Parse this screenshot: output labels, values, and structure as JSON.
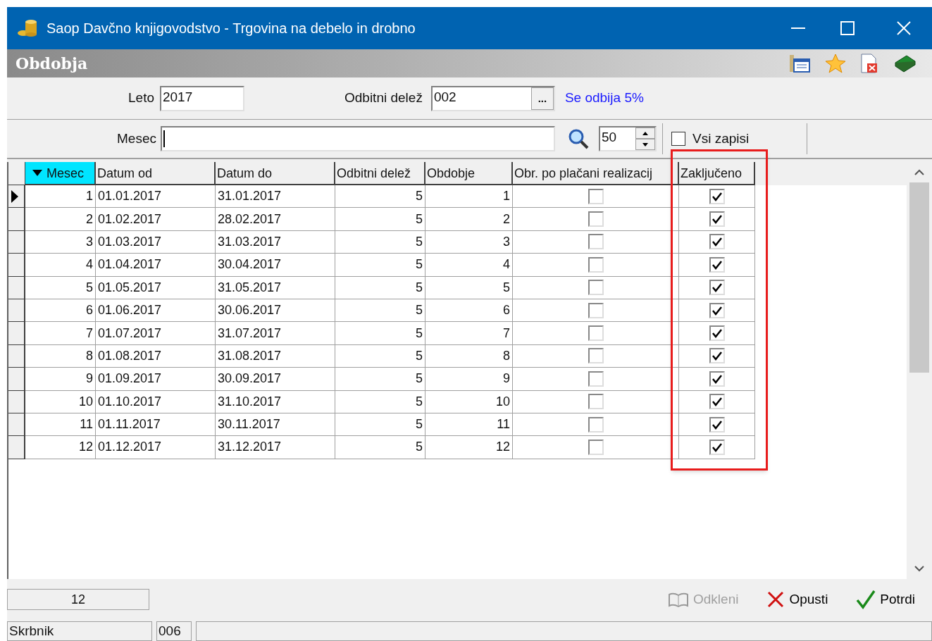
{
  "window": {
    "title": "Saop Davčno knjigovodstvo - Trgovina na debelo in drobno"
  },
  "panel_title": "Obdobja",
  "form": {
    "leto_label": "Leto",
    "leto_value": "2017",
    "delez_label": "Odbitni delež",
    "delez_value": "002",
    "delez_button": "...",
    "delez_note": "Se odbija 5%",
    "mesec_label": "Mesec",
    "page_size": "50",
    "all_records_label": "Vsi zapisi",
    "all_records_checked": false
  },
  "table": {
    "columns": [
      {
        "label": "Mesec",
        "sorted": true
      },
      {
        "label": "Datum od",
        "sorted": false
      },
      {
        "label": "Datum do",
        "sorted": false
      },
      {
        "label": "Odbitni delež",
        "sorted": false
      },
      {
        "label": "Obdobje",
        "sorted": false
      },
      {
        "label": "Obr. po plačani realizacij",
        "sorted": false
      },
      {
        "label": "Zaključeno",
        "sorted": false
      }
    ],
    "rows": [
      {
        "selected": true,
        "mesec": "1",
        "od": "01.01.2017",
        "do": "31.01.2017",
        "delez": "5",
        "obdobje": "1",
        "obr": false,
        "zakljuceno": true
      },
      {
        "selected": false,
        "mesec": "2",
        "od": "01.02.2017",
        "do": "28.02.2017",
        "delez": "5",
        "obdobje": "2",
        "obr": false,
        "zakljuceno": true
      },
      {
        "selected": false,
        "mesec": "3",
        "od": "01.03.2017",
        "do": "31.03.2017",
        "delez": "5",
        "obdobje": "3",
        "obr": false,
        "zakljuceno": true
      },
      {
        "selected": false,
        "mesec": "4",
        "od": "01.04.2017",
        "do": "30.04.2017",
        "delez": "5",
        "obdobje": "4",
        "obr": false,
        "zakljuceno": true
      },
      {
        "selected": false,
        "mesec": "5",
        "od": "01.05.2017",
        "do": "31.05.2017",
        "delez": "5",
        "obdobje": "5",
        "obr": false,
        "zakljuceno": true
      },
      {
        "selected": false,
        "mesec": "6",
        "od": "01.06.2017",
        "do": "30.06.2017",
        "delez": "5",
        "obdobje": "6",
        "obr": false,
        "zakljuceno": true
      },
      {
        "selected": false,
        "mesec": "7",
        "od": "01.07.2017",
        "do": "31.07.2017",
        "delez": "5",
        "obdobje": "7",
        "obr": false,
        "zakljuceno": true
      },
      {
        "selected": false,
        "mesec": "8",
        "od": "01.08.2017",
        "do": "31.08.2017",
        "delez": "5",
        "obdobje": "8",
        "obr": false,
        "zakljuceno": true
      },
      {
        "selected": false,
        "mesec": "9",
        "od": "01.09.2017",
        "do": "30.09.2017",
        "delez": "5",
        "obdobje": "9",
        "obr": false,
        "zakljuceno": true
      },
      {
        "selected": false,
        "mesec": "10",
        "od": "01.10.2017",
        "do": "31.10.2017",
        "delez": "5",
        "obdobje": "10",
        "obr": false,
        "zakljuceno": true
      },
      {
        "selected": false,
        "mesec": "11",
        "od": "01.11.2017",
        "do": "30.11.2017",
        "delez": "5",
        "obdobje": "11",
        "obr": false,
        "zakljuceno": true
      },
      {
        "selected": false,
        "mesec": "12",
        "od": "01.12.2017",
        "do": "31.12.2017",
        "delez": "5",
        "obdobje": "12",
        "obr": false,
        "zakljuceno": true
      }
    ]
  },
  "record_count": "12",
  "buttons": [
    {
      "label": "Odkleni",
      "kind": "unlock",
      "disabled": true
    },
    {
      "label": "Opusti",
      "kind": "cancel",
      "disabled": false
    },
    {
      "label": "Potrdi",
      "kind": "confirm",
      "disabled": false
    }
  ],
  "status_bar": {
    "user": "Skrbnik",
    "code": "006"
  }
}
